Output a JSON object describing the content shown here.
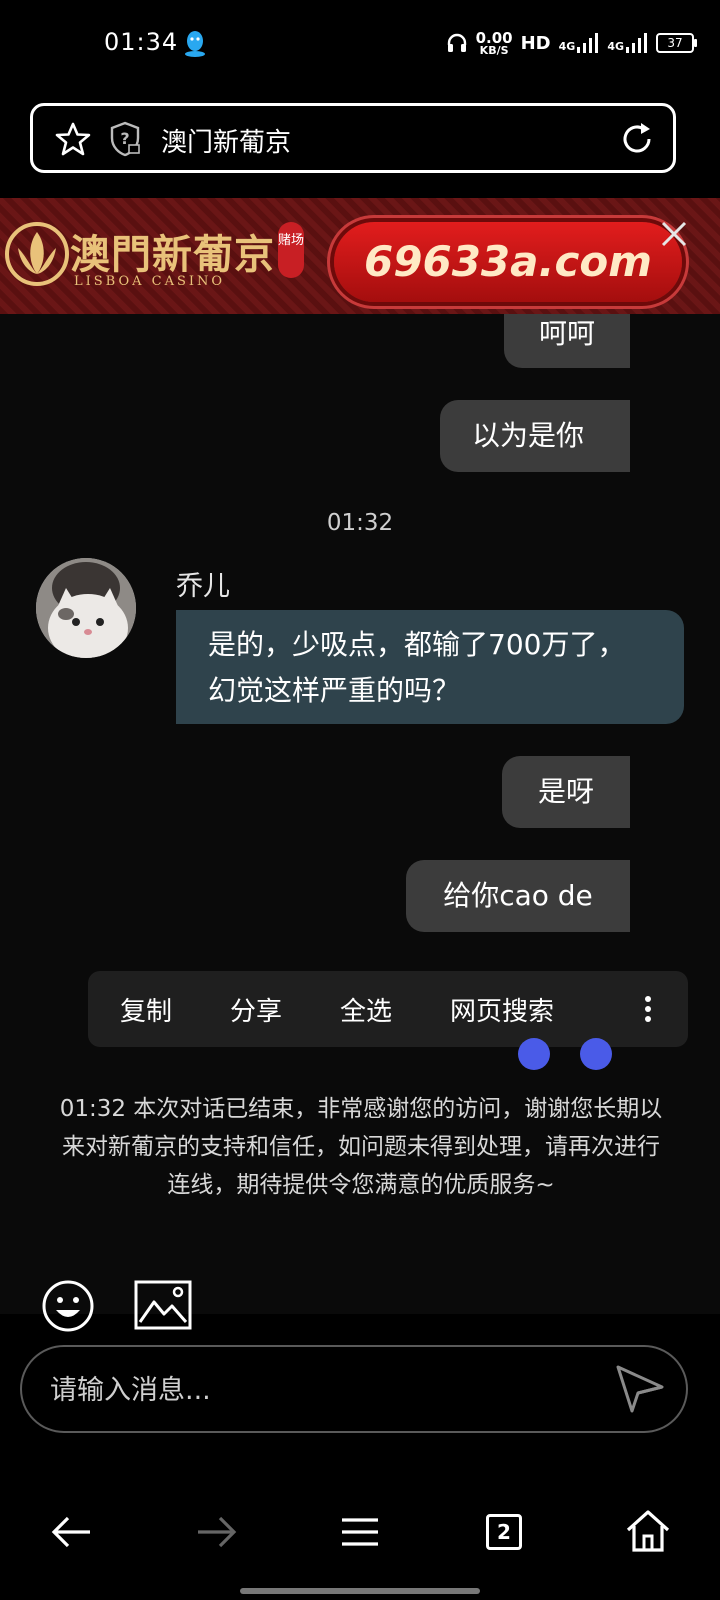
{
  "status": {
    "time": "01:34",
    "net_speed_value": "0.00",
    "net_speed_unit": "KB/S",
    "hd": "HD",
    "sim1": "4G",
    "sim2": "4G",
    "battery": "37"
  },
  "browser": {
    "address": "澳门新葡京"
  },
  "ad": {
    "brand": "澳門新葡京",
    "sub": "LISBOA CASINO",
    "badge": "赌场",
    "url": "69633a.com"
  },
  "chat": {
    "messages": [
      {
        "side": "right",
        "text": "呵呵"
      },
      {
        "side": "right",
        "text": "以为是你"
      }
    ],
    "timestamp": "01:32",
    "sender_name": "乔儿",
    "incoming_text": "是的，少吸点，都输了700万了，幻觉这样严重的吗？",
    "reply1": "是呀",
    "reply2": "给你cao de"
  },
  "context_menu": {
    "items": [
      "复制",
      "分享",
      "全选",
      "网页搜索"
    ]
  },
  "end_notice": "01:32  本次对话已结束，非常感谢您的访问，谢谢您长期以来对新葡京的支持和信任，如问题未得到处理，请再次进行连线，期待提供令您满意的优质服务~",
  "composer": {
    "placeholder": "请输入消息..."
  },
  "nav": {
    "tabs_count": "2"
  }
}
